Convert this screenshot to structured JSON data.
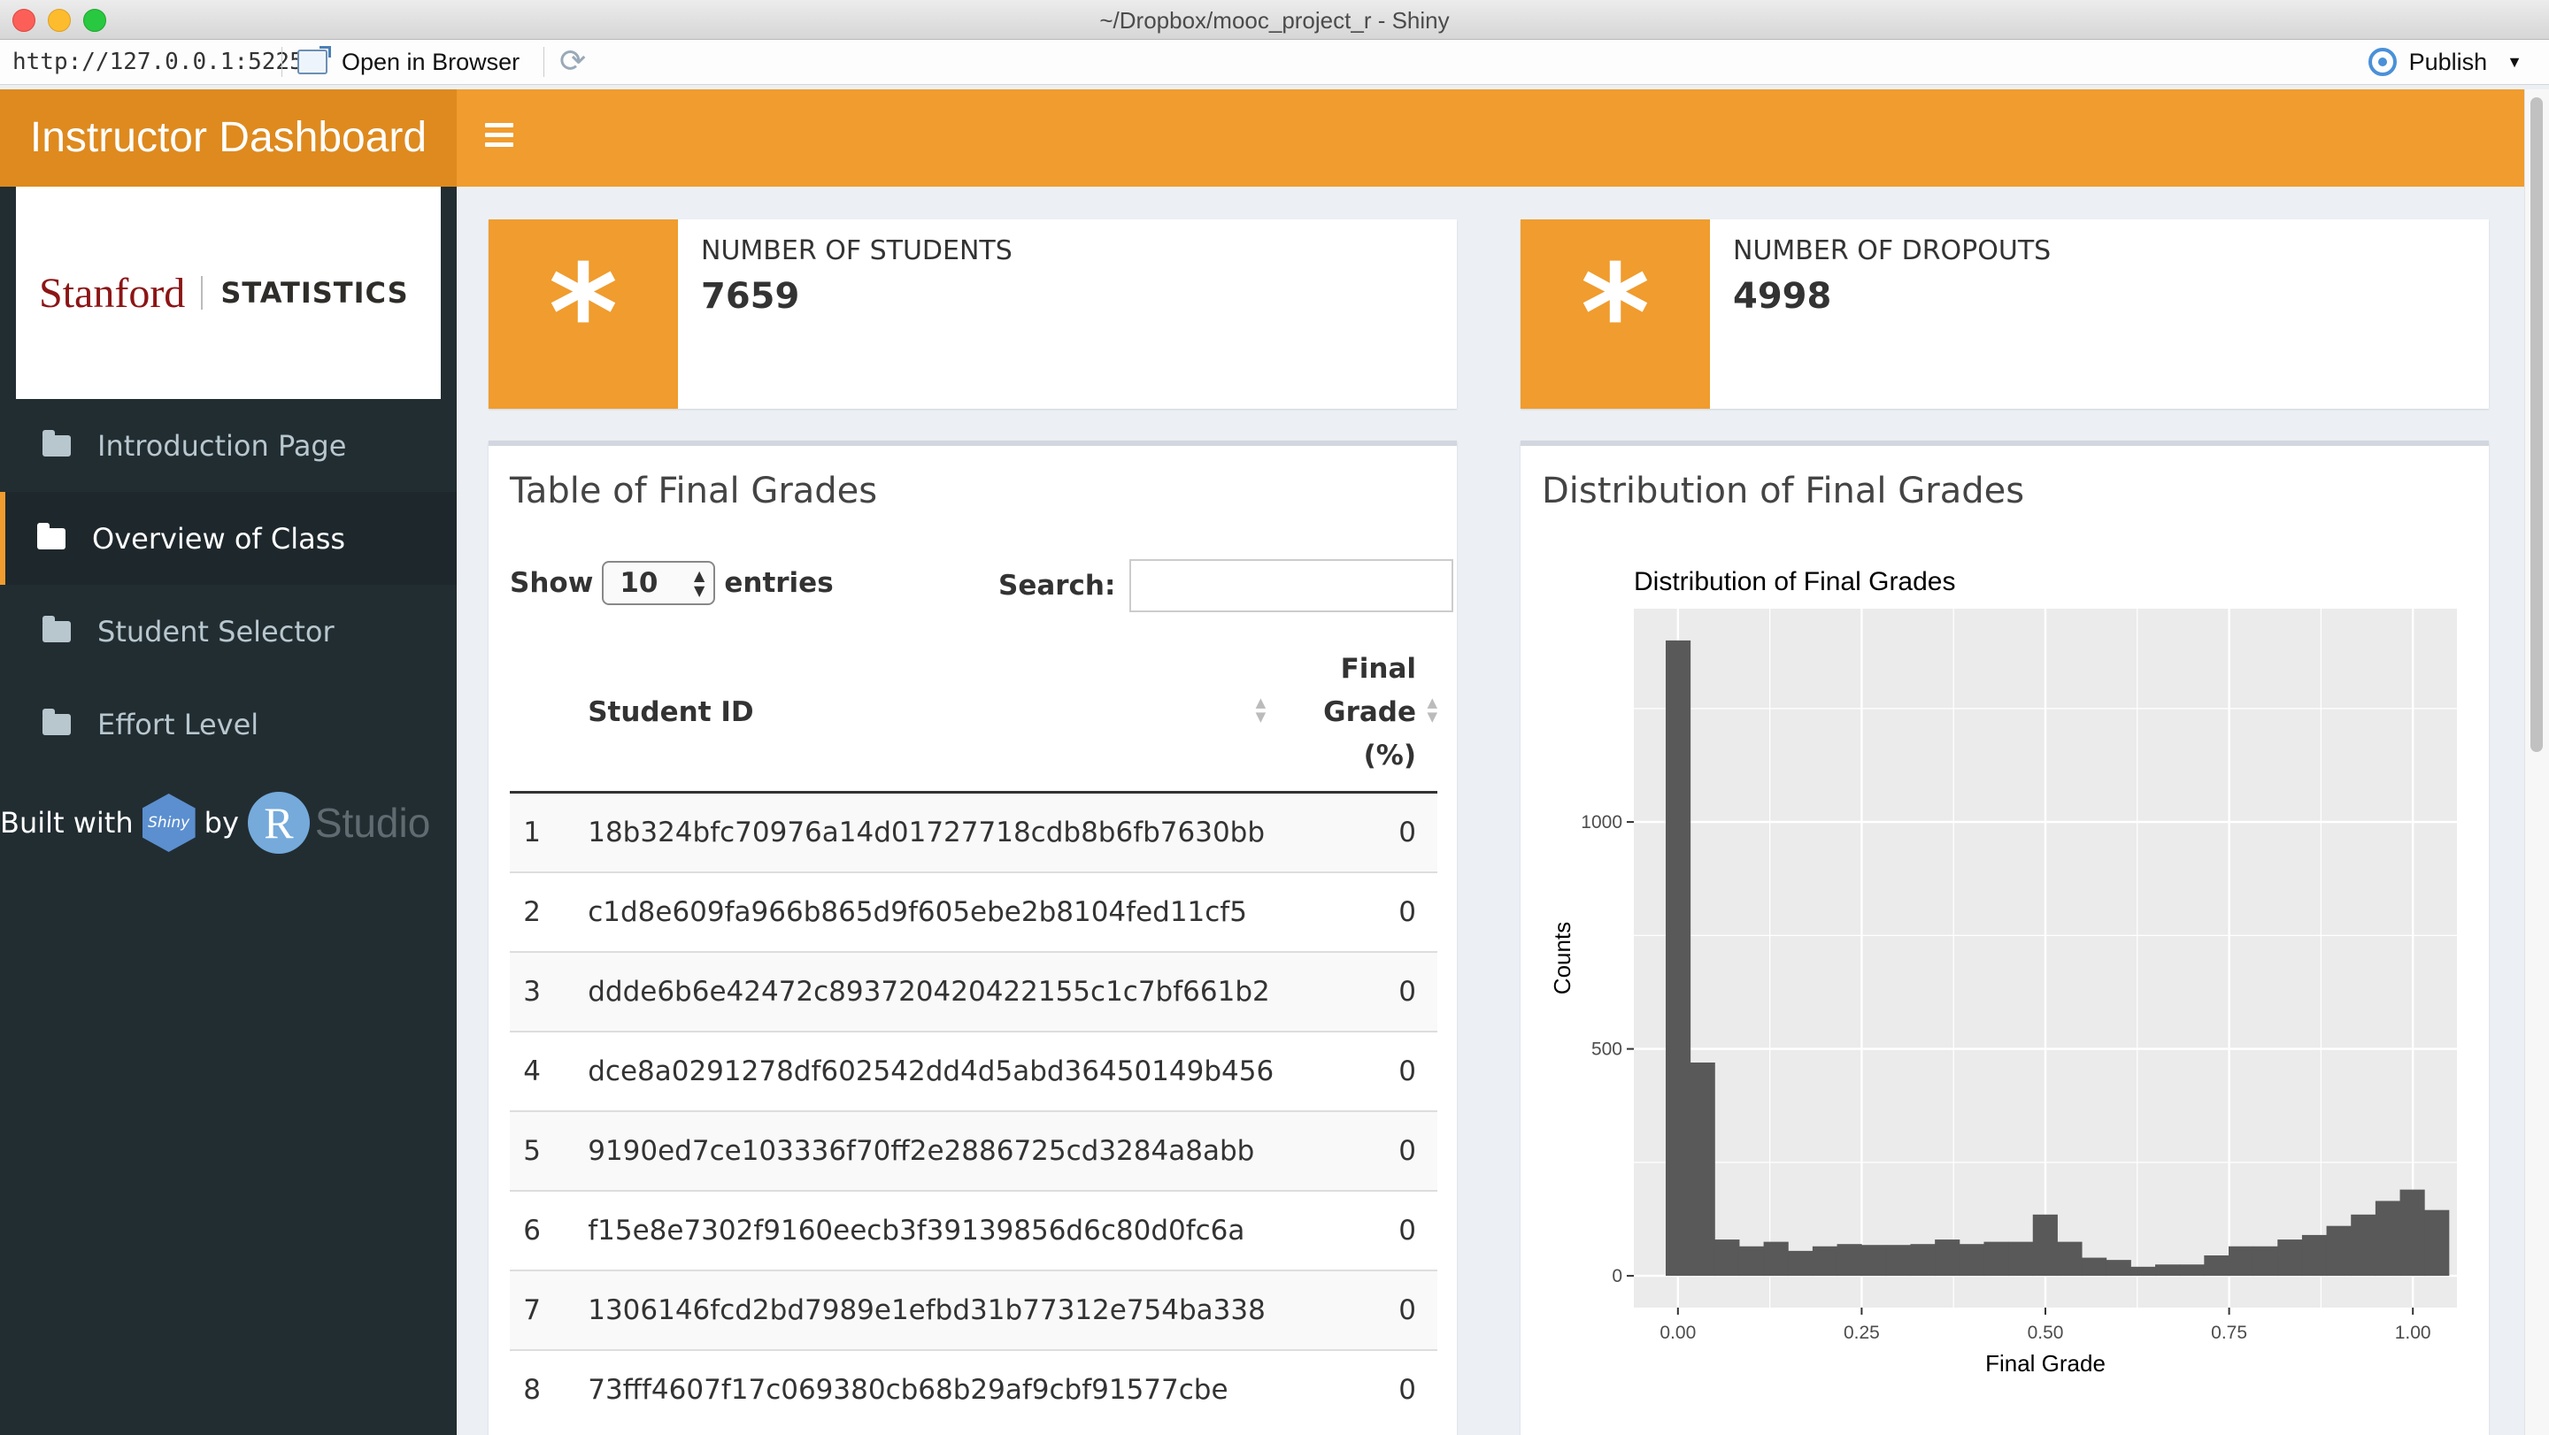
{
  "window": {
    "title": "~/Dropbox/mooc_project_r - Shiny"
  },
  "viewer": {
    "url": "http://127.0.0.1:5225",
    "open_in_browser": "Open in Browser",
    "publish": "Publish"
  },
  "header": {
    "title": "Instructor Dashboard"
  },
  "sidebar": {
    "brand": {
      "stanford": "Stanford",
      "statistics": "STATISTICS"
    },
    "items": [
      {
        "label": "Introduction Page",
        "icon": "folder-icon",
        "active": false
      },
      {
        "label": "Overview of Class",
        "icon": "folder-icon",
        "active": true
      },
      {
        "label": "Student Selector",
        "icon": "folder-icon",
        "active": false
      },
      {
        "label": "Effort Level",
        "icon": "folder-icon",
        "active": false
      }
    ],
    "built_with": {
      "built": "Built with",
      "shiny": "Shiny",
      "by": "by",
      "r": "R",
      "studio": "Studio"
    }
  },
  "info_boxes": [
    {
      "label": "NUMBER OF STUDENTS",
      "value": "7659",
      "icon": "asterisk-icon",
      "color": "#f39c12"
    },
    {
      "label": "NUMBER OF DROPOUTS",
      "value": "4998",
      "icon": "asterisk-icon",
      "color": "#f39c12"
    }
  ],
  "table_box": {
    "title": "Table of Final Grades",
    "show_label": "Show",
    "show_value": "10",
    "entries_label": "entries",
    "search_label": "Search:",
    "columns": {
      "student_id": "Student ID",
      "final_grade": [
        "Final",
        "Grade",
        "(%)"
      ]
    },
    "rows": [
      {
        "idx": "1",
        "id": "18b324bfc70976a14d01727718cdb8b6fb7630bb",
        "grade": "0"
      },
      {
        "idx": "2",
        "id": "c1d8e609fa966b865d9f605ebe2b8104fed11cf5",
        "grade": "0"
      },
      {
        "idx": "3",
        "id": "ddde6b6e42472c893720420422155c1c7bf661b2",
        "grade": "0"
      },
      {
        "idx": "4",
        "id": "dce8a0291278df602542dd4d5abd36450149b456",
        "grade": "0"
      },
      {
        "idx": "5",
        "id": "9190ed7ce103336f70ff2e2886725cd3284a8abb",
        "grade": "0"
      },
      {
        "idx": "6",
        "id": "f15e8e7302f9160eecb3f39139856d6c80d0fc6a",
        "grade": "0"
      },
      {
        "idx": "7",
        "id": "1306146fcd2bd7989e1efbd31b77312e754ba338",
        "grade": "0"
      },
      {
        "idx": "8",
        "id": "73fff4607f17c069380cb68b29af9cbf91577cbe",
        "grade": "0"
      }
    ]
  },
  "chart_box": {
    "title": "Distribution of Final Grades"
  },
  "chart_data": {
    "type": "bar",
    "title": "Distribution of Final Grades",
    "xlabel": "Final Grade",
    "ylabel": "Counts",
    "xlim": [
      -0.06,
      1.06
    ],
    "ylim": [
      -70,
      1470
    ],
    "xticks": [
      {
        "value": 0,
        "label": "0.00"
      },
      {
        "value": 0.25,
        "label": "0.25"
      },
      {
        "value": 0.5,
        "label": "0.50"
      },
      {
        "value": 0.75,
        "label": "0.75"
      },
      {
        "value": 1,
        "label": "1.00"
      }
    ],
    "yticks": [
      {
        "value": 0,
        "label": "0"
      },
      {
        "value": 500,
        "label": "500"
      },
      {
        "value": 1000,
        "label": "1000"
      }
    ],
    "bin_width": 0.0333,
    "bin_centers": [
      0,
      0.0333,
      0.0667,
      0.1,
      0.1333,
      0.1667,
      0.2,
      0.2333,
      0.2667,
      0.3,
      0.3333,
      0.3667,
      0.4,
      0.4333,
      0.4667,
      0.5,
      0.5333,
      0.5667,
      0.6,
      0.6333,
      0.6667,
      0.7,
      0.7333,
      0.7667,
      0.8,
      0.8333,
      0.8667,
      0.9,
      0.9333,
      0.9667,
      1
    ],
    "values": [
      1400,
      470,
      80,
      65,
      75,
      55,
      65,
      70,
      68,
      68,
      70,
      80,
      70,
      75,
      75,
      135,
      75,
      40,
      35,
      20,
      25,
      25,
      45,
      65,
      65,
      80,
      90,
      110,
      135,
      165,
      190,
      145
    ],
    "grid": true,
    "background": "#ebebeb",
    "bar_color": "#595959"
  }
}
